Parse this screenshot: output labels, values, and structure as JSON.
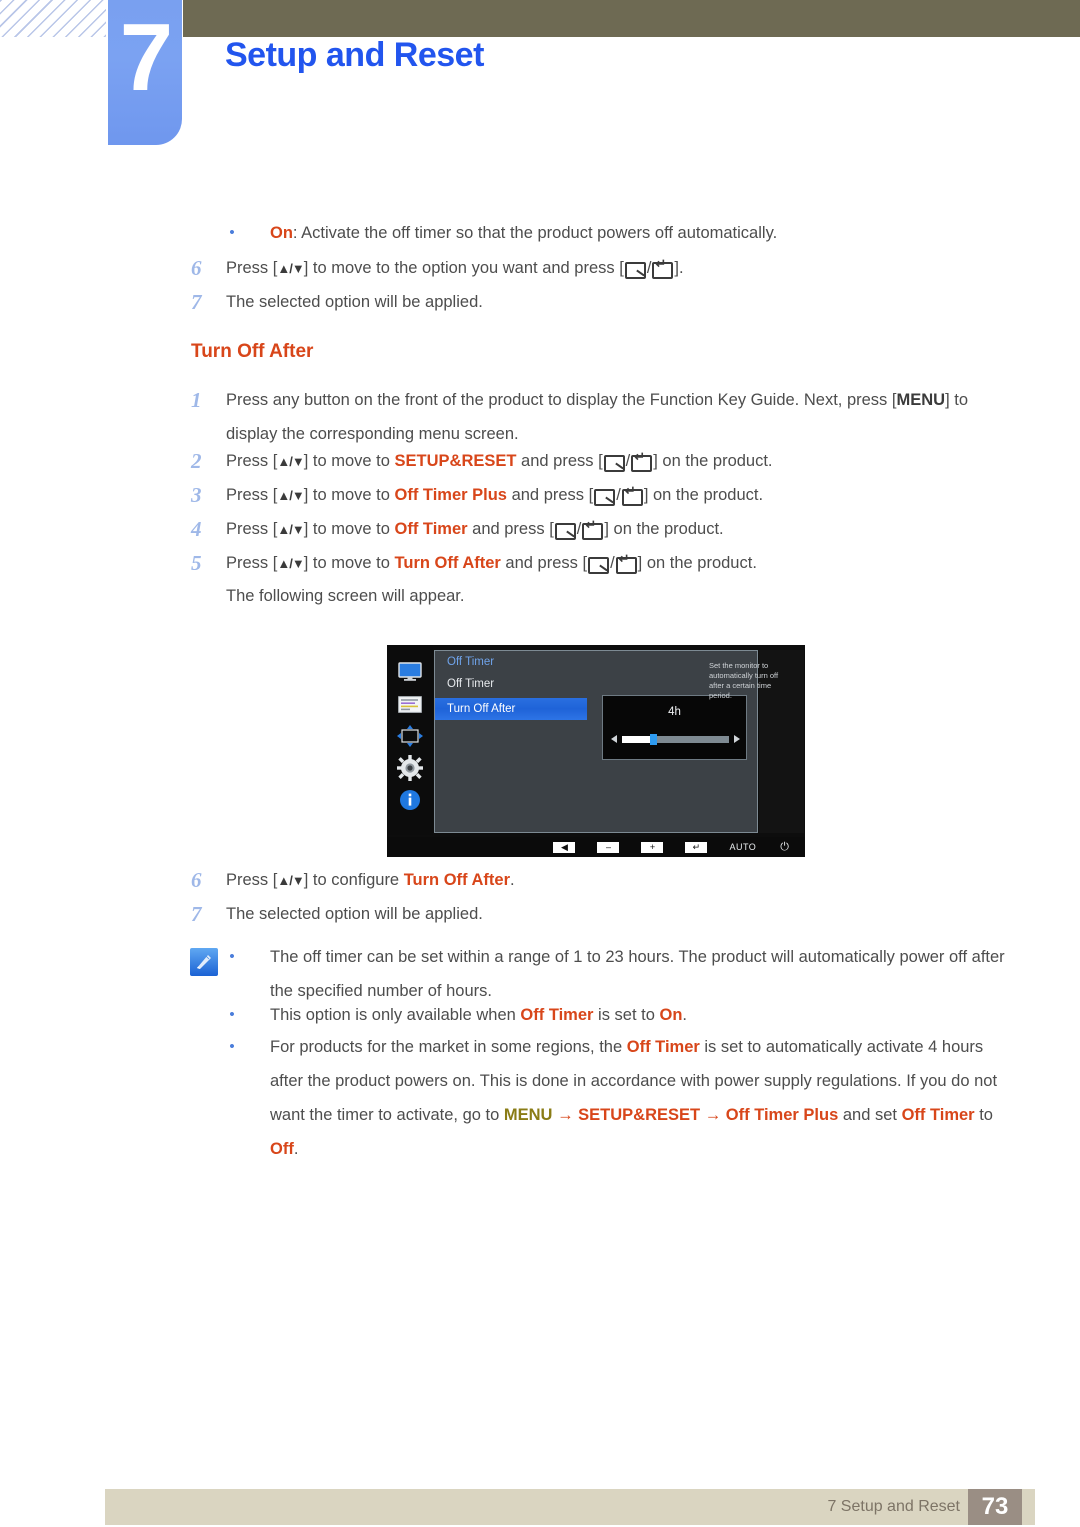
{
  "header": {
    "chapter_number": "7",
    "chapter_title": "Setup and Reset",
    "accent_blue": "#2255ee",
    "tab_blue": "#7ba2f2",
    "bar_olive": "#6e6a53"
  },
  "intro": {
    "bullet_on_label": "On",
    "bullet_on_text": ": Activate the off timer so that the product powers off automatically.",
    "step6_num": "6",
    "step6_a": "Press [",
    "step6_arrows": "▲/▼",
    "step6_b": "] to move to the option you want and press [",
    "step6_c": "].",
    "step7_num": "7",
    "step7_text": "The selected option will be applied."
  },
  "section": {
    "title": "Turn Off After",
    "steps": [
      {
        "num": "1",
        "parts": [
          {
            "t": "Press any button on the front of the product to display the Function Key Guide. Next, press [",
            "style": "plain"
          },
          {
            "t": "MENU",
            "style": "bold"
          },
          {
            "t": "] to display the corresponding menu screen.",
            "style": "plain"
          }
        ]
      },
      {
        "num": "2",
        "target": "SETUP&RESET",
        "pre": "Press [",
        "mid": "] to move to ",
        "post": " and press [",
        "end": "] on the product."
      },
      {
        "num": "3",
        "target": "Off Timer Plus",
        "pre": "Press [",
        "mid": "] to move to ",
        "post": " and press [",
        "end": "] on the product."
      },
      {
        "num": "4",
        "target": "Off Timer",
        "pre": "Press [",
        "mid": "] to move to ",
        "post": " and press [",
        "end": "] on the product."
      },
      {
        "num": "5",
        "target": "Turn Off After",
        "pre": "Press [",
        "mid": "] to move to ",
        "post": " and press [",
        "end": "] on the product."
      }
    ],
    "following_screen": "The following screen will appear.",
    "arrows_glyph": "▲/▼"
  },
  "osd": {
    "sidebar_icons": [
      "monitor-icon",
      "osd-list-icon",
      "size-position-icon",
      "gear-icon",
      "info-icon"
    ],
    "menu_header": "Off Timer",
    "item1": "Off Timer",
    "item2": "Turn Off After",
    "value": "4h",
    "help_text": "Set the monitor to automatically turn off after a certain time period.",
    "bottom_buttons": [
      "◀",
      "–",
      "+",
      "↵"
    ],
    "auto_label": "AUTO",
    "power_glyph": "⏻",
    "highlight_color": "#2a6fe0",
    "panel_color": "#3c4146",
    "slider": {
      "value": 4,
      "min": 1,
      "max": 23,
      "fill_percent": 30
    }
  },
  "after_steps": {
    "step6_num": "6",
    "step6_pre": "Press [",
    "step6_mid": "] to configure ",
    "step6_target": "Turn Off After",
    "step6_end": ".",
    "step7_num": "7",
    "step7_text": "The selected option will be applied."
  },
  "notes": {
    "icon": "note-pencil-icon",
    "items": [
      {
        "id": "note-1",
        "line1": "The off timer can be set within a range of 1 to 23 hours. The product will automatically power off",
        "line2": "after the specified number of hours."
      },
      {
        "id": "note-2",
        "pre": "This option is only available when ",
        "term1": "Off Timer",
        "mid": " is set to ",
        "term2": "On",
        "end": "."
      },
      {
        "id": "note-3",
        "line1_pre": "For products for the market in some regions, the ",
        "line1_term": "Off Timer",
        "line1_post": " is set to automatically activate 4 hours",
        "line2": "after the product powers on. This is done in accordance with power supply regulations. If you do",
        "line3_pre": "not want the timer to activate, go to ",
        "line3_menu": "MENU",
        "line3_arrow1": "→",
        "line3_setup": "SETUP&RESET",
        "line3_arrow2": "→",
        "line3_otp": "Off Timer Plus",
        "line3_and": " and set ",
        "line4_term": "Off Timer",
        "line4_mid": " to ",
        "line4_off": "Off",
        "line4_end": "."
      }
    ]
  },
  "footer": {
    "label": "7 Setup and Reset",
    "page": "73",
    "bar_color": "#dad5c1",
    "page_box_color": "#9a8e84"
  }
}
